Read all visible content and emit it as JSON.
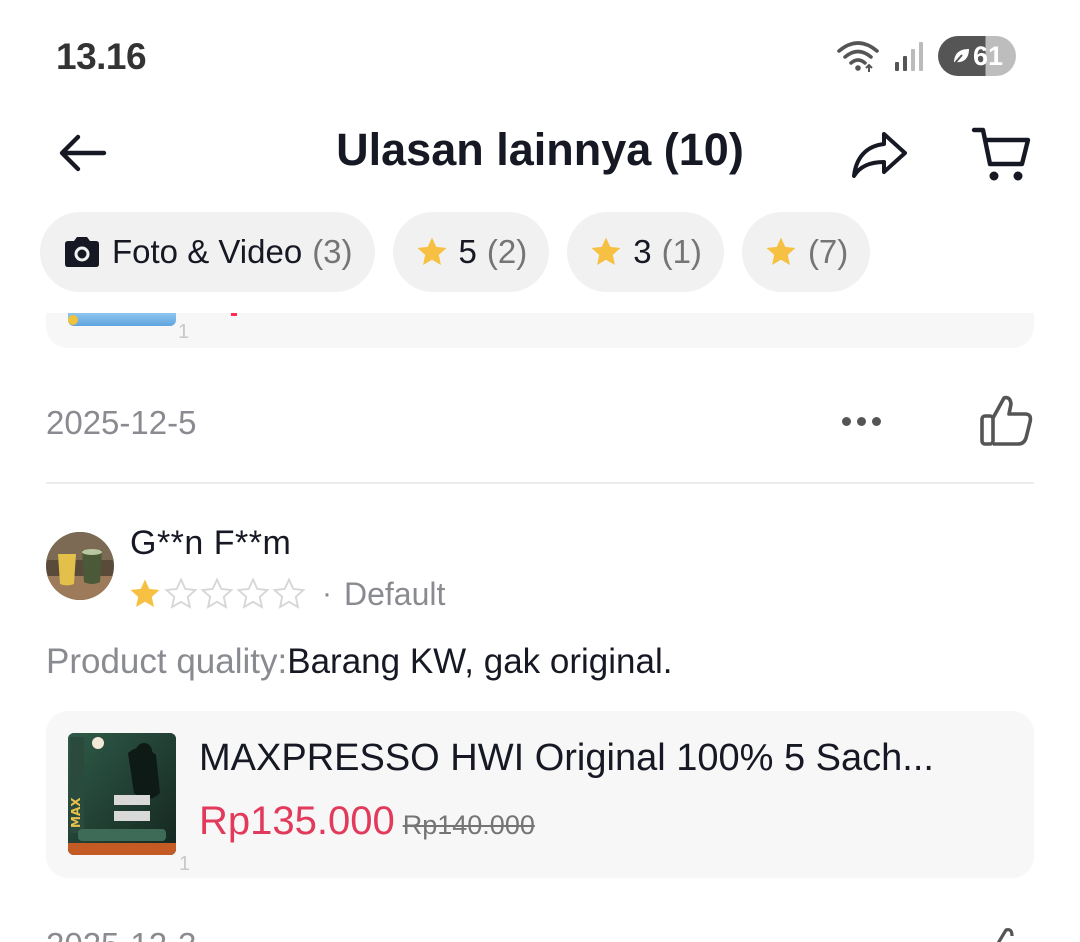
{
  "status_bar": {
    "time": "13.16",
    "battery": "61"
  },
  "header": {
    "title": "Ulasan lainnya (10)"
  },
  "filters": [
    {
      "label": "Foto & Video",
      "count": "(3)",
      "icon": "camera-icon"
    },
    {
      "label": "5",
      "count": "(2)",
      "icon": "star-icon"
    },
    {
      "label": "3",
      "count": "(1)",
      "icon": "star-icon"
    },
    {
      "label": "",
      "count": "(7)",
      "icon": "star-icon"
    }
  ],
  "previous_review": {
    "date": "2025-12-5"
  },
  "review": {
    "reviewer_name": "G**n F**m",
    "rating": 1,
    "max_rating": 5,
    "variant": "Default",
    "text_label": "Product quality:",
    "text": "Barang KW, gak original."
  },
  "product": {
    "name": "MAXPRESSO HWI Original 100% 5 Sach...",
    "price": "Rp135.000",
    "original_price": "Rp140.000",
    "thumb_index": "1"
  },
  "colors": {
    "accent": "#e23a5b",
    "star": "#f6c042",
    "chip_bg": "#f1f1f2",
    "card_bg": "#f7f7f8"
  }
}
